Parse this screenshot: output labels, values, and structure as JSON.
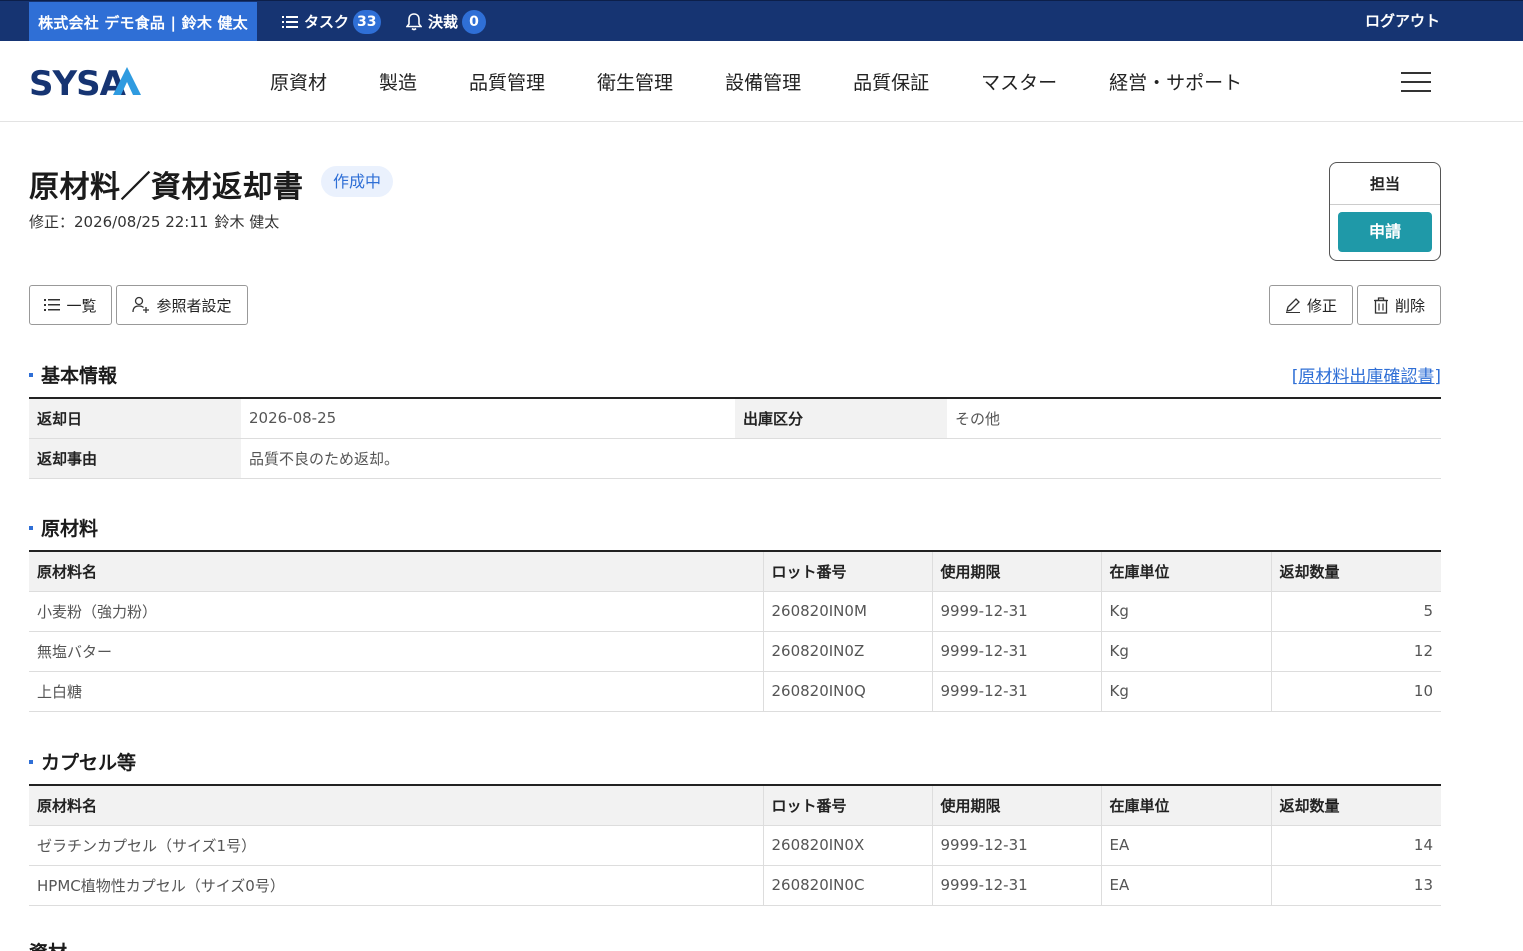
{
  "topbar": {
    "company": "株式会社 デモ食品 | 鈴木 健太",
    "tasks_label": "タスク",
    "tasks_count": "33",
    "approvals_label": "決裁",
    "approvals_count": "0",
    "logout": "ログアウト"
  },
  "header": {
    "logo": "SYSA",
    "nav": [
      "原資材",
      "製造",
      "品質管理",
      "衛生管理",
      "設備管理",
      "品質保証",
      "マスター",
      "経営・サポート"
    ]
  },
  "page": {
    "title": "原材料／資材返却書",
    "status": "作成中",
    "modified_label": "修正：2026/08/25 22:11",
    "modified_user": "鈴木 健太",
    "approval_label": "担当",
    "apply_button": "申請",
    "list_button": "一覧",
    "reference_button": "参照者設定",
    "edit_button": "修正",
    "delete_button": "削除"
  },
  "basic": {
    "section_title": "基本情報",
    "link": "[原材料出庫確認書]",
    "return_date_label": "返却日",
    "return_date": "2026-08-25",
    "category_label": "出庫区分",
    "category": "その他",
    "reason_label": "返却事由",
    "reason": "品質不良のため返却。"
  },
  "materials": {
    "section_title": "原材料",
    "headers": [
      "原材料名",
      "ロット番号",
      "使用期限",
      "在庫単位",
      "返却数量"
    ],
    "rows": [
      [
        "小麦粉（強力粉）",
        "260820IN0M",
        "9999-12-31",
        "Kg",
        "5"
      ],
      [
        "無塩バター",
        "260820IN0Z",
        "9999-12-31",
        "Kg",
        "12"
      ],
      [
        "上白糖",
        "260820IN0Q",
        "9999-12-31",
        "Kg",
        "10"
      ]
    ]
  },
  "capsules": {
    "section_title": "カプセル等",
    "headers": [
      "原材料名",
      "ロット番号",
      "使用期限",
      "在庫単位",
      "返却数量"
    ],
    "rows": [
      [
        "ゼラチンカプセル（サイズ1号）",
        "260820IN0X",
        "9999-12-31",
        "EA",
        "14"
      ],
      [
        "HPMC植物性カプセル（サイズ0号）",
        "260820IN0C",
        "9999-12-31",
        "EA",
        "13"
      ]
    ]
  },
  "next_section_partial": "資材"
}
